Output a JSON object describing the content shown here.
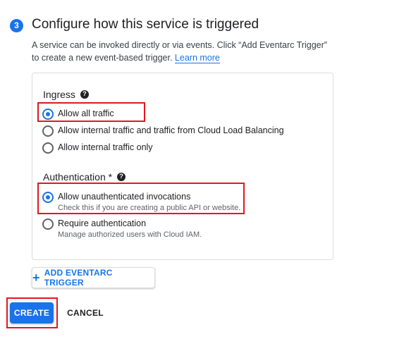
{
  "section": {
    "step_number": "3",
    "title": "Configure how this service is triggered",
    "description": "A service can be invoked directly or via events. Click “Add Eventarc Trigger” to create a new event-based trigger.",
    "learn_more": "Learn more"
  },
  "ingress": {
    "title": "Ingress",
    "options": [
      {
        "label": "Allow all traffic",
        "checked": true
      },
      {
        "label": "Allow internal traffic and traffic from Cloud Load Balancing",
        "checked": false
      },
      {
        "label": "Allow internal traffic only",
        "checked": false
      }
    ]
  },
  "authentication": {
    "title": "Authentication *",
    "options": [
      {
        "label": "Allow unauthenticated invocations",
        "sublabel": "Check this if you are creating a public API or website.",
        "checked": true
      },
      {
        "label": "Require authentication",
        "sublabel": "Manage authorized users with Cloud IAM.",
        "checked": false
      }
    ]
  },
  "buttons": {
    "add_trigger": "ADD EVENTARC TRIGGER",
    "create": "CREATE",
    "cancel": "CANCEL"
  },
  "colors": {
    "accent": "#1a73e8",
    "highlight": "#e0191f",
    "text": "#202124",
    "secondary_text": "#5f6368",
    "border": "#dadce0"
  },
  "icons": {
    "step": "step-number-badge",
    "help": "help-circle-icon",
    "add": "plus-icon"
  }
}
